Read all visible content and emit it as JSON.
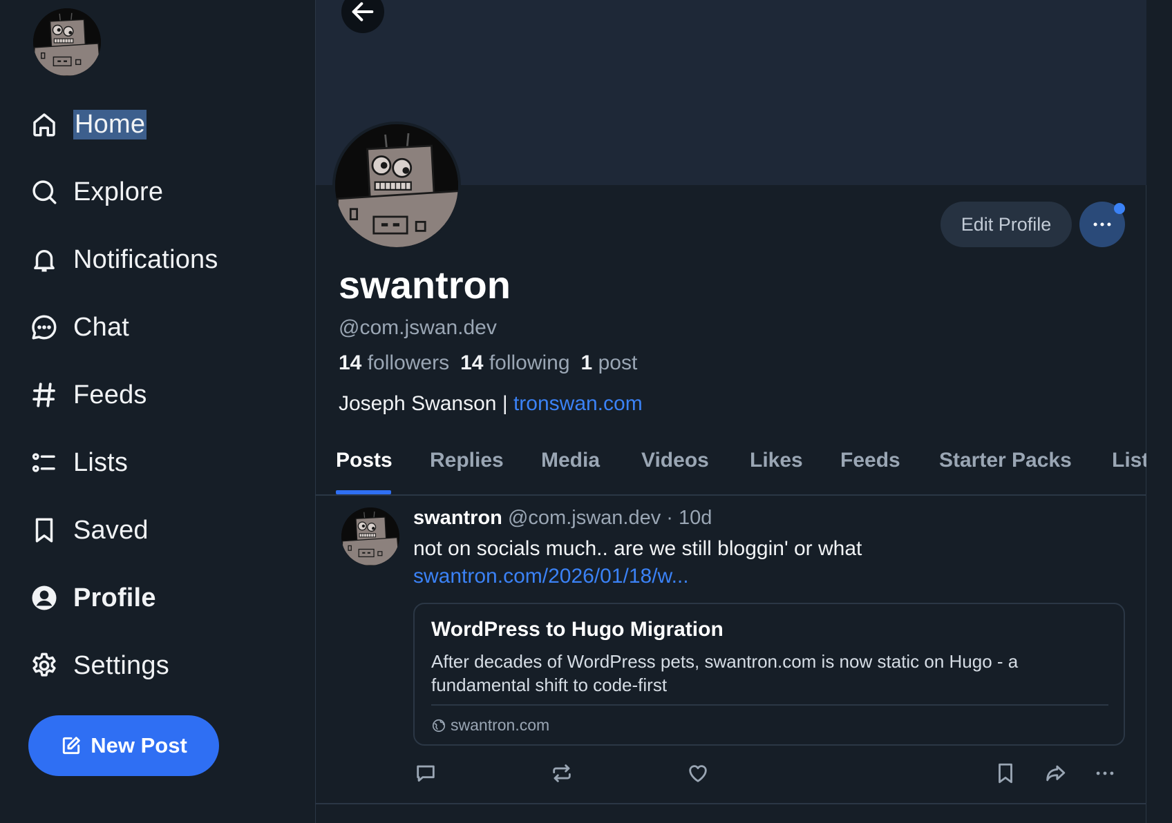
{
  "nav": {
    "items": [
      {
        "label": "Home",
        "icon": "home-icon"
      },
      {
        "label": "Explore",
        "icon": "search-icon"
      },
      {
        "label": "Notifications",
        "icon": "bell-icon"
      },
      {
        "label": "Chat",
        "icon": "chat-icon"
      },
      {
        "label": "Feeds",
        "icon": "hash-icon"
      },
      {
        "label": "Lists",
        "icon": "list-icon"
      },
      {
        "label": "Saved",
        "icon": "bookmark-icon"
      },
      {
        "label": "Profile",
        "icon": "profile-icon"
      },
      {
        "label": "Settings",
        "icon": "gear-icon"
      }
    ],
    "active_item": "Profile",
    "new_post_label": "New Post"
  },
  "profile": {
    "display_name": "swantron",
    "handle": "@com.jswan.dev",
    "followers_count": "14",
    "followers_label": "followers",
    "following_count": "14",
    "following_label": "following",
    "posts_count": "1",
    "posts_label": "post",
    "bio_text": "Joseph Swanson | ",
    "bio_link": "tronswan.com",
    "edit_profile_label": "Edit Profile"
  },
  "tabs": [
    "Posts",
    "Replies",
    "Media",
    "Videos",
    "Likes",
    "Feeds",
    "Starter Packs",
    "Lists"
  ],
  "active_tab": "Posts",
  "post": {
    "author": "swantron",
    "meta": " @com.jswan.dev · 10d",
    "text": "not on socials much.. are we still bloggin' or what",
    "link": "swantron.com/2026/01/18/w...",
    "card": {
      "title": "WordPress to Hugo Migration",
      "description": "After decades of WordPress pets, swantron.com is now static on Hugo - a fundamental shift to code-first",
      "domain": "swantron.com"
    }
  },
  "colors": {
    "background": "#161e27",
    "banner": "#1e2837",
    "accent": "#2f6ff3",
    "link": "#3b82f6",
    "muted_text": "#9aa6b4"
  }
}
